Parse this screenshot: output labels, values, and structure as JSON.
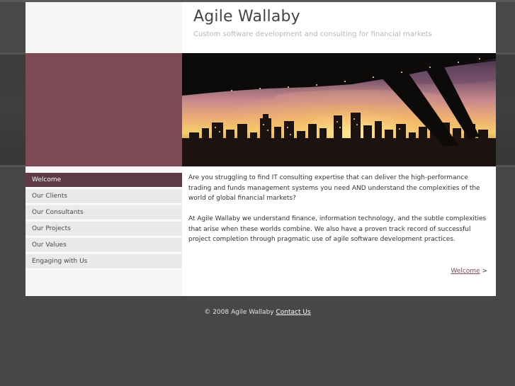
{
  "header": {
    "title": "Agile Wallaby",
    "tagline": "Custom software development and consulting for financial markets"
  },
  "nav": {
    "items": [
      {
        "label": "Welcome",
        "active": true
      },
      {
        "label": "Our Clients",
        "active": false
      },
      {
        "label": "Our Consultants",
        "active": false
      },
      {
        "label": "Our Projects",
        "active": false
      },
      {
        "label": "Our Values",
        "active": false
      },
      {
        "label": "Engaging with Us",
        "active": false
      }
    ]
  },
  "content": {
    "paragraph_1": "Are you struggling to find IT consulting expertise that can deliver the high-performance trading and funds management systems you need AND understand the complexities of the world of global financial markets?",
    "paragraph_2": "At Agile Wallaby we understand finance, information technology, and the subtle complexities that arise when these worlds combine. We also have a proven track record of successful project completion through pragmatic use of agile software development practices.",
    "next_link_label": "Welcome",
    "next_link_arrow": ">"
  },
  "footer": {
    "copyright": "© 2008 Agile Wallaby",
    "contact_label": "Contact Us"
  },
  "colors": {
    "accent": "#7c4a55",
    "nav_active": "#5e3a44",
    "page_background": "#474747"
  }
}
